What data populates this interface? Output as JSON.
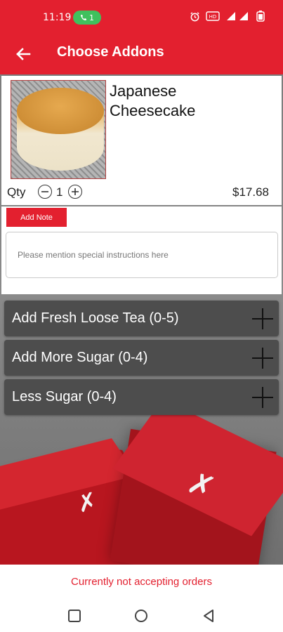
{
  "status_bar": {
    "time": "11:19",
    "call_badge": "1",
    "call_badge_color": "#3fc15d",
    "icons": [
      "alarm-icon",
      "volte-icon",
      "signal-icon",
      "battery-icon"
    ]
  },
  "app_bar": {
    "title": "Choose Addons",
    "back_icon": "arrow-left-icon",
    "color": "#e3202f"
  },
  "product": {
    "name": "Japanese Cheesecake",
    "qty_label": "Qty",
    "quantity": "1",
    "price": "$17.68",
    "image": "cheesecake-photo"
  },
  "note": {
    "button_label": "Add Note",
    "placeholder": "Please mention special instructions here",
    "value": ""
  },
  "addons": [
    {
      "label": "Add Fresh Loose Tea (0-5)"
    },
    {
      "label": "Add More Sugar (0-4)"
    },
    {
      "label": "Less Sugar (0-4)"
    }
  ],
  "footer": {
    "notice": "Currently not accepting orders",
    "notice_color": "#e3202f"
  },
  "nav_bar": {
    "buttons": [
      "recent-apps-icon",
      "home-icon",
      "back-triangle-icon"
    ]
  }
}
